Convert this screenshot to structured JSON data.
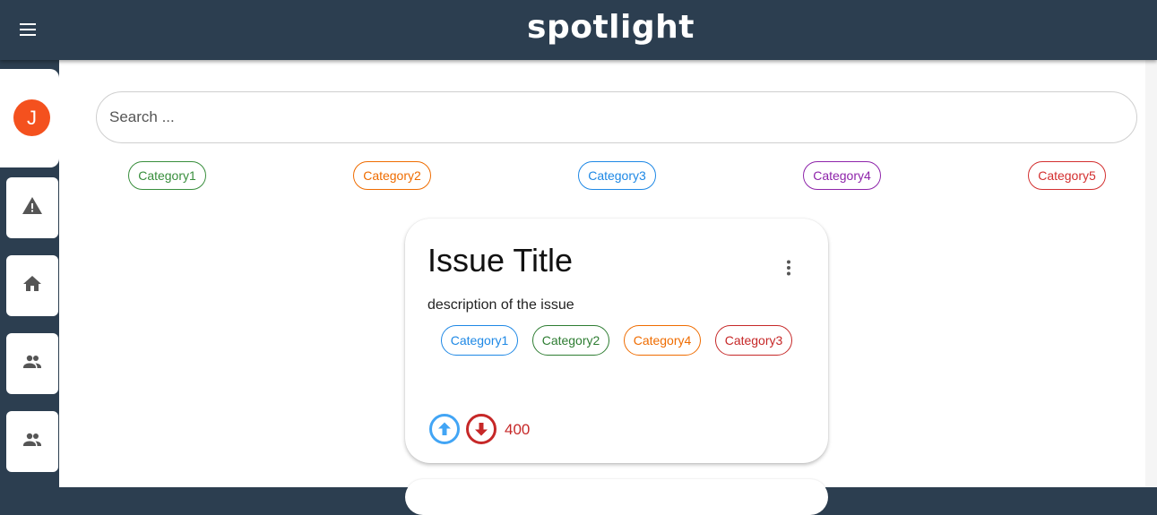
{
  "app": {
    "title": "spotlight"
  },
  "profile": {
    "initial": "J",
    "avatar_color": "#f4511e"
  },
  "sidebar": {
    "items": [
      {
        "icon": "warning-icon"
      },
      {
        "icon": "home-icon"
      },
      {
        "icon": "people-icon"
      },
      {
        "icon": "people-icon"
      }
    ]
  },
  "search": {
    "placeholder": "Search ...",
    "value": ""
  },
  "filters": {
    "categories": [
      {
        "label": "Category1",
        "color": "#388e3c"
      },
      {
        "label": "Category2",
        "color": "#ef6c00"
      },
      {
        "label": "Category3",
        "color": "#1e88e5"
      },
      {
        "label": "Category4",
        "color": "#8e24aa"
      },
      {
        "label": "Category5",
        "color": "#d32f2f"
      }
    ]
  },
  "issue": {
    "title": "Issue Title",
    "description": "description of the issue",
    "categories": [
      {
        "label": "Category1",
        "color": "#1e88e5"
      },
      {
        "label": "Category2",
        "color": "#2e7d32"
      },
      {
        "label": "Category4",
        "color": "#ef6c00"
      },
      {
        "label": "Category3",
        "color": "#c62828"
      }
    ],
    "vote_count": "400",
    "upvote_color": "#42a5f5",
    "downvote_color": "#c62828"
  },
  "colors": {
    "topbar": "#2c3e50"
  }
}
